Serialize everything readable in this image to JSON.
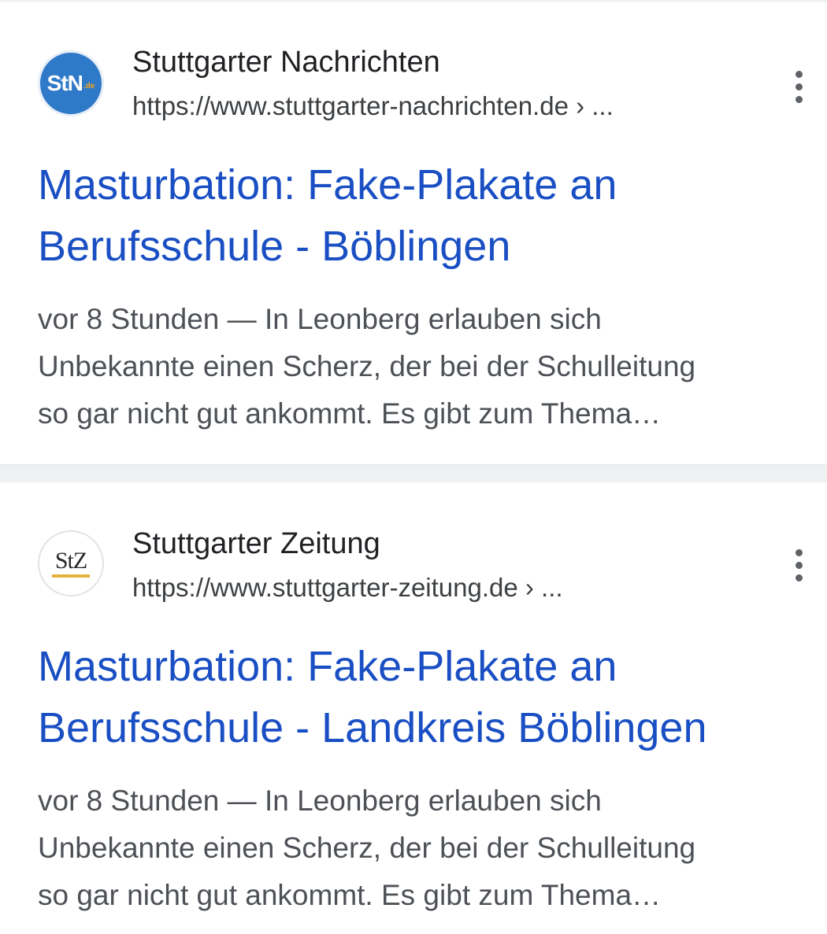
{
  "results": [
    {
      "favicon_text": "StN",
      "favicon_suffix": ".de",
      "site_name": "Stuttgarter Nachrichten",
      "url": "https://www.stuttgarter-nachrichten.de › ...",
      "title_lines": [
        "Masturbation: Fake-Plakate an",
        "Berufsschule - Böblingen"
      ],
      "snippet_lines": [
        "vor 8 Stunden — In Leonberg erlauben sich",
        "Unbekannte einen Scherz, der bei der Schulleitung",
        "so gar nicht gut ankommt. Es gibt zum Thema…"
      ],
      "favicon_color": "#2f79c9"
    },
    {
      "favicon_text": "StZ",
      "site_name": "Stuttgarter Zeitung",
      "url": "https://www.stuttgarter-zeitung.de › ...",
      "title_lines": [
        "Masturbation: Fake-Plakate an",
        "Berufsschule - Landkreis Böblingen"
      ],
      "snippet_lines": [
        "vor 8 Stunden — In Leonberg erlauben sich",
        "Unbekannte einen Scherz, der bei der Schulleitung",
        "so gar nicht gut ankommt. Es gibt zum Thema…"
      ],
      "favicon_color": "#e8b23a"
    }
  ],
  "icons": {
    "more": "more-vert-icon"
  },
  "colors": {
    "title_link": "#1a4fc4",
    "site_name": "#202124",
    "url": "#3c4043",
    "snippet": "#4d5156"
  }
}
